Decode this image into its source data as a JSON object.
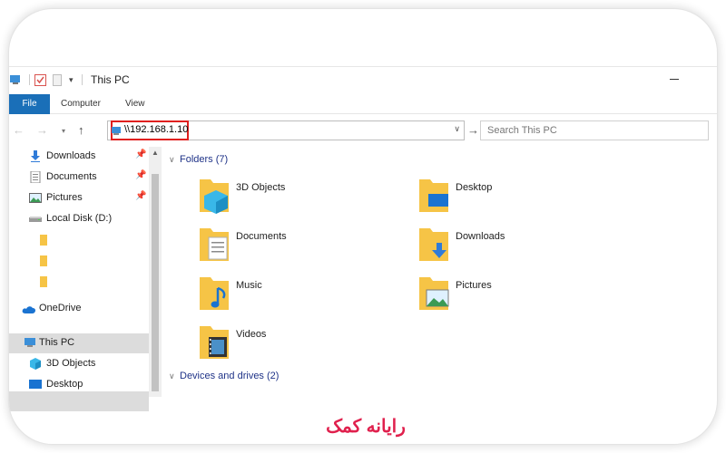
{
  "window": {
    "title": "This PC"
  },
  "ribbon": {
    "tabs": [
      "File",
      "Computer",
      "View"
    ]
  },
  "address_bar": {
    "value": "\\\\192.168.1.10"
  },
  "search": {
    "placeholder": "Search This PC"
  },
  "sidebar": {
    "quick_access": [
      {
        "label": "Downloads",
        "icon": "downloads-icon",
        "pinned": true
      },
      {
        "label": "Documents",
        "icon": "documents-icon",
        "pinned": true
      },
      {
        "label": "Pictures",
        "icon": "pictures-icon",
        "pinned": true
      },
      {
        "label": "Local Disk (D:)",
        "icon": "drive-icon",
        "pinned": false
      }
    ],
    "onedrive": "OneDrive",
    "this_pc": "This PC",
    "this_pc_children": [
      {
        "label": "3D Objects",
        "icon": "3d-objects-icon"
      },
      {
        "label": "Desktop",
        "icon": "desktop-icon"
      }
    ]
  },
  "content": {
    "folders_header": "Folders (7)",
    "folders": [
      {
        "label": "3D Objects",
        "icon": "3d-objects-folder-icon"
      },
      {
        "label": "Desktop",
        "icon": "desktop-folder-icon"
      },
      {
        "label": "Documents",
        "icon": "documents-folder-icon"
      },
      {
        "label": "Downloads",
        "icon": "downloads-folder-icon"
      },
      {
        "label": "Music",
        "icon": "music-folder-icon"
      },
      {
        "label": "Pictures",
        "icon": "pictures-folder-icon"
      },
      {
        "label": "Videos",
        "icon": "videos-folder-icon"
      }
    ],
    "devices_header": "Devices and drives (2)"
  },
  "brand": {
    "text": "رایانه کمک",
    "color": "#e0204d"
  },
  "colors": {
    "accent": "#1a6fb8",
    "highlight": "#e0201f",
    "folder": "#f6c446"
  }
}
